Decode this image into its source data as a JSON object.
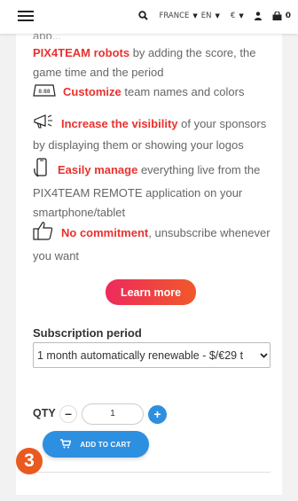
{
  "navbar": {
    "country": "FRANCE",
    "language": "EN",
    "currency": "€",
    "cart_count": "0"
  },
  "content": {
    "intro_partial_line": "app...",
    "intro_red": "PIX4TEAM robots",
    "intro_rest_1": " by adding the score, the",
    "intro_rest_2": "game time and the period",
    "f1_red": "Customize",
    "f1_rest": " team names and colors",
    "f2_red": "Increase the visibility",
    "f2_rest_1": " of your sponsors",
    "f2_rest_2": "by displaying them or showing your logos",
    "f3_red": "Easily manage",
    "f3_rest_1": " everything live from the",
    "f3_rest_2": "PIX4TEAM REMOTE application on your",
    "f3_rest_3": "smartphone/tablet",
    "f4_red": "No commitment",
    "f4_rest_1": ", unsubscribe whenever",
    "f4_rest_2": "you want"
  },
  "actions": {
    "learn_more": "Learn more",
    "subscription_label": "Subscription period",
    "subscription_value": "1 month automatically renewable - $/€29 t",
    "qty_label": "QTY",
    "qty_minus": "–",
    "qty_value": "1",
    "qty_plus": "+",
    "add_to_cart": "ADD TO CART"
  },
  "badge": {
    "step": "3"
  },
  "colors": {
    "accent_red": "#e8322f",
    "button_blue": "#2d8fe0",
    "badge_orange": "#e85a1f"
  }
}
